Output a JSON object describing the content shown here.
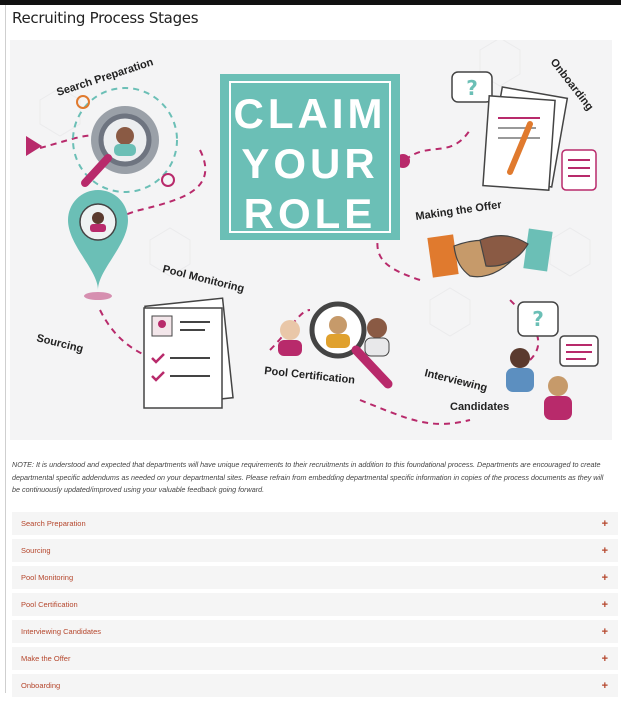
{
  "page": {
    "title": "Recruiting Process Stages"
  },
  "infographic": {
    "headline": [
      "CLAIM",
      "YOUR",
      "ROLE"
    ],
    "stages": {
      "search_preparation": "Search Preparation",
      "sourcing": "Sourcing",
      "pool_monitoring": "Pool Monitoring",
      "pool_certification": "Pool Certification",
      "interviewing_candidates_1": "Interviewing",
      "interviewing_candidates_2": "Candidates",
      "making_the_offer": "Making the Offer",
      "onboarding": "Onboarding"
    },
    "colors": {
      "teal": "#6bbfb6",
      "magenta": "#b82a6b",
      "accent": "#e07a2e"
    }
  },
  "note": "NOTE: It is understood and expected that departments will have unique requirements to their recruitments in addition to this foundational process. Departments are encouraged to create departmental specific addendums as needed on your departmental sites. Please refrain from embedding departmental specific information in copies of the process documents as they will be continuously updated/improved using your valuable feedback going forward.",
  "accordion": {
    "expand_symbol": "+",
    "items": [
      "Search Preparation",
      "Sourcing",
      "Pool Monitoring",
      "Pool Certification",
      "Interviewing Candidates",
      "Make the Offer",
      "Onboarding"
    ]
  }
}
